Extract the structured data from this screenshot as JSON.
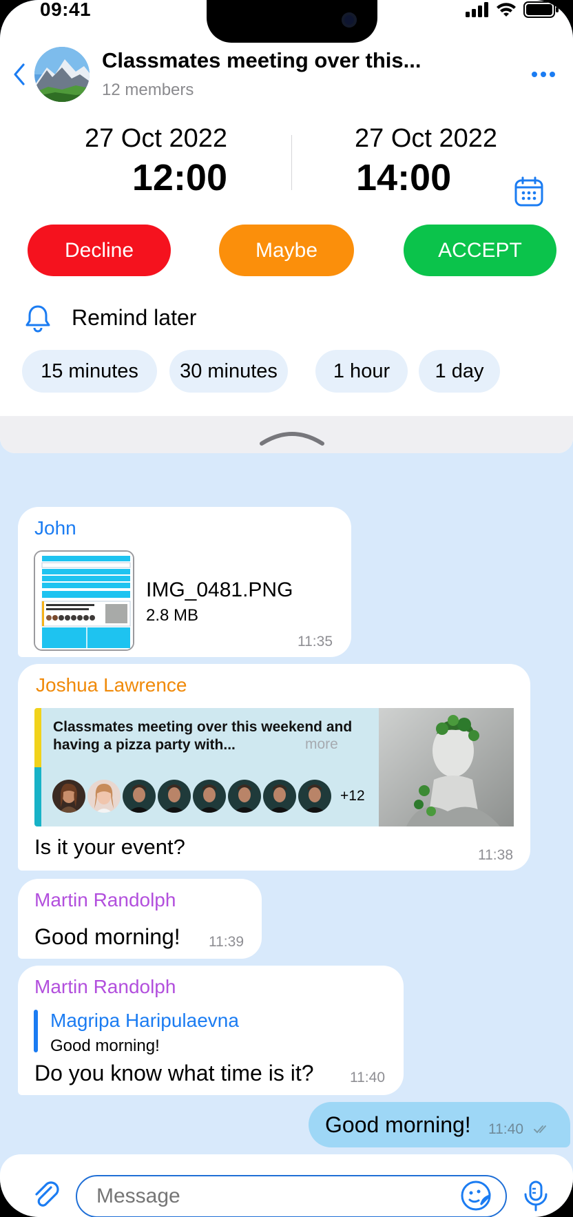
{
  "status_bar": {
    "time": "09:41"
  },
  "header": {
    "title": "Classmates meeting over this...",
    "subtitle": "12 members"
  },
  "event": {
    "start_date": "27 Oct 2022",
    "start_time": "12:00",
    "end_date": "27 Oct 2022",
    "end_time": "14:00"
  },
  "rsvp": {
    "decline": "Decline",
    "maybe": "Maybe",
    "accept": "ACCEPT"
  },
  "remind": {
    "label": "Remind later",
    "options": [
      "15 minutes",
      "30 minutes",
      "1 hour",
      "1 day"
    ]
  },
  "messages": [
    {
      "sender": "John",
      "sender_color": "#1b7cf2",
      "file_name": "IMG_0481.PNG",
      "file_size": "2.8 MB",
      "time": "11:35"
    },
    {
      "sender": "Joshua Lawrence",
      "sender_color": "#f08a0a",
      "card_title": "Classmates meeting over this weekend and having a pizza party with...",
      "card_more": "more",
      "card_extra": "+12",
      "text": "Is it your event?",
      "time": "11:38"
    },
    {
      "sender": "Martin Randolph",
      "sender_color": "#b24fdd",
      "text": "Good morning!",
      "time": "11:39"
    },
    {
      "sender": "Martin Randolph",
      "sender_color": "#b24fdd",
      "reply_name": "Magripa Haripulaevna",
      "reply_text": "Good morning!",
      "text": "Do you know what time is it?",
      "time": "11:40"
    },
    {
      "outgoing": true,
      "text": "Good morning!",
      "time": "11:40"
    }
  ],
  "input": {
    "placeholder": "Message"
  },
  "colors": {
    "accent": "#1b7cf2",
    "decline": "#f5121e",
    "maybe": "#fb8f0b",
    "accept": "#0bc34b",
    "chat_bg": "#d8e9fb",
    "outgoing_bubble": "#9ed7f6"
  },
  "icons": [
    "back-chevron-icon",
    "more-dots-icon",
    "calendar-icon",
    "bell-icon",
    "collapse-chevron-icon",
    "attach-clip-icon",
    "sticker-icon",
    "microphone-icon",
    "read-check-icon"
  ]
}
